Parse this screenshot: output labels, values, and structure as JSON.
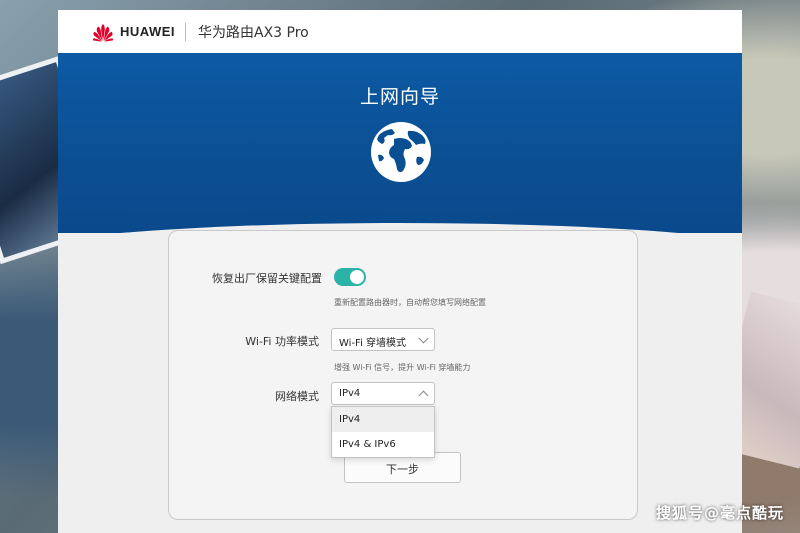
{
  "header": {
    "brand": "HUAWEI",
    "product": "华为路由AX3 Pro"
  },
  "banner": {
    "title": "上网向导"
  },
  "form": {
    "restore": {
      "label": "恢复出厂保留关键配置",
      "enabled": true,
      "hint": "重新配置路由器时，自动帮您填写网络配置"
    },
    "wifi_mode": {
      "label": "Wi-Fi 功率模式",
      "value": "Wi-Fi 穿墙模式",
      "hint": "增强 Wi-Fi 信号，提升 Wi-Fi 穿墙能力"
    },
    "network_mode": {
      "label": "网络模式",
      "value": "IPv4",
      "options": [
        "IPv4",
        "IPv4 & IPv6"
      ]
    },
    "next_label": "下一步"
  },
  "watermark": "搜狐号@毫点酷玩",
  "colors": {
    "banner_blue": "#0b4f93",
    "toggle_on": "#2bb3a6",
    "logo_red": "#e0002a"
  },
  "icons": [
    "huawei-logo-icon",
    "globe-icon",
    "chevron-down-icon"
  ]
}
